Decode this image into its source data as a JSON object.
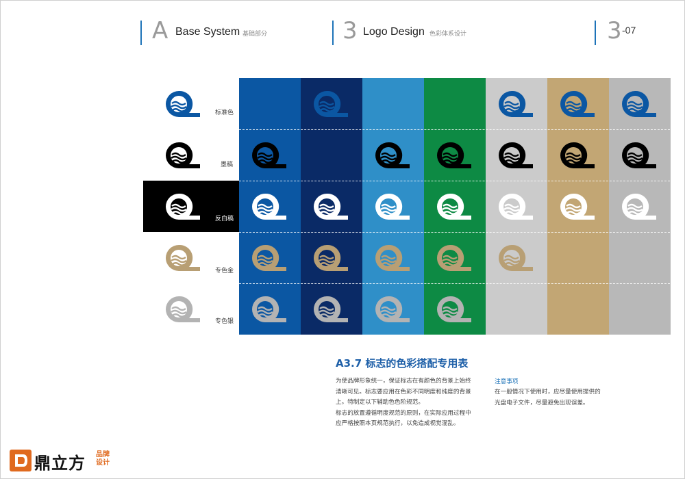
{
  "header": {
    "section_letter": "A",
    "section_title": "Base System",
    "section_sub": "基础部分",
    "chapter_number": "3",
    "chapter_title": "Logo Design",
    "chapter_sub": "色彩体系设计",
    "page_number": "3",
    "page_suffix": "-07"
  },
  "grid": {
    "row_labels": [
      "标准色",
      "墨稿",
      "反白稿",
      "专色金",
      "专色银"
    ],
    "columns": [
      {
        "bg": "#0b57a3",
        "logos": [
          null,
          "#000000",
          "#ffffff",
          "#b89f74",
          "#b3b3b3"
        ]
      },
      {
        "bg": "#0a2a66",
        "logos": [
          "#0b57a3",
          null,
          "#ffffff",
          "#b89f74",
          "#b3b3b3"
        ]
      },
      {
        "bg": "#2f8fc8",
        "logos": [
          null,
          "#000000",
          "#ffffff",
          "#b89f74",
          "#b3b3b3"
        ]
      },
      {
        "bg": "#0d8a44",
        "logos": [
          null,
          "#000000",
          "#ffffff",
          "#b89f74",
          "#b3b3b3"
        ]
      },
      {
        "bg": "#cbcbcb",
        "logos": [
          "#0b57a3",
          "#000000",
          "#ffffff",
          "#b89f74",
          null
        ]
      },
      {
        "bg": "#c2a674",
        "logos": [
          "#0b57a3",
          "#000000",
          "#ffffff",
          null,
          null
        ]
      },
      {
        "bg": "#b8b8b8",
        "logos": [
          "#0b57a3",
          "#000000",
          "#ffffff",
          null,
          null
        ]
      }
    ],
    "side_logos": [
      "#0b57a3",
      "#000000",
      "#ffffff",
      "#b89f74",
      "#b3b3b3"
    ]
  },
  "section": {
    "title": "A3.7  标志的色彩搭配专用表",
    "body_lines": [
      "为使品牌形象统一，保证标志在有颜色的背景上始终",
      "清晰可见。标志要应用在色彩不同明度和纯度的背景",
      "上。特制定以下辅助色色阶规范。",
      "标志的放置遵循明度规范的原则，在实际应用过程中",
      "应严格按照本页规范执行，以免造成视觉混乱。"
    ],
    "note_title": "注意事项",
    "note_lines": [
      "在一般情况下使用时，应尽量使用提供的",
      "光盘电子文件，尽量避免出现误差。"
    ]
  },
  "brand": {
    "name": "鼎立方",
    "tag_line1": "品牌",
    "tag_line2": "设计",
    "color": "#e06a1f"
  }
}
